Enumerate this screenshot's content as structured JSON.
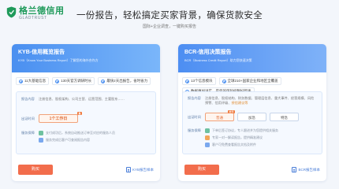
{
  "brand": {
    "name_cn": "格兰德信用",
    "name_en": "GLADTRUST",
    "color": "#1e9a5a"
  },
  "headline": "一份报告，轻松搞定买家背景，确保货款安全",
  "subline": "国际+企业调查，一键购买报告",
  "kyb": {
    "title": "KYB-信用概览报告",
    "subtitle": "KYB（Know Your Business Report）了解您的海外合作方",
    "features": [
      "11大基础信息",
      "130天官方调研时长",
      "最快2天出报告，省时省力"
    ],
    "rows": [
      {
        "label": "报告内容",
        "value": "注册信息、股权架构、公司主营、运营范围、主要股东……"
      },
      {
        "label": "出证时间",
        "value": "1个工作日"
      },
      {
        "label": "服务保障",
        "value": ""
      }
    ],
    "price_tag": "急",
    "services": [
      "支付成功后，系统自动推送订单至对应的服务人员",
      "服务完成后客户可查阅报告内容"
    ],
    "buy_label": "购买",
    "sample_label": "KYB报告样本"
  },
  "bcr": {
    "title": "BCR-信用决策报告",
    "subtitle": "BCR（Business Credit Report）助力您快速决策",
    "features": [
      "13个信息模块",
      "全球210+国家企业和地区全覆盖",
      "数据更加详实，是您的风险控制好帮手"
    ],
    "rows": [
      {
        "label": "报告内容",
        "value_prefix": "注册信息、股权结构、财务数据、管理层信息、重大事件、经营规模、风险预警、信用评级、",
        "value_highlight": "授信建议等"
      },
      {
        "label": "出证时间",
        "value": ""
      },
      {
        "label": "服务保障",
        "value": ""
      }
    ],
    "options": [
      {
        "label": "普通",
        "tag": "推荐",
        "selected": true
      },
      {
        "label": "加急",
        "tag": "",
        "selected": false
      },
      {
        "label": "特急",
        "tag": "",
        "selected": false
      }
    ],
    "services": [
      "下单后签订协议，专人跟进并为您提供相关服务",
      "专家一对一解读报告，提供精准建议",
      "客户可免费查看报告文档及附件"
    ],
    "buy_label": "购买",
    "sample_label": "BCR报告样本"
  }
}
